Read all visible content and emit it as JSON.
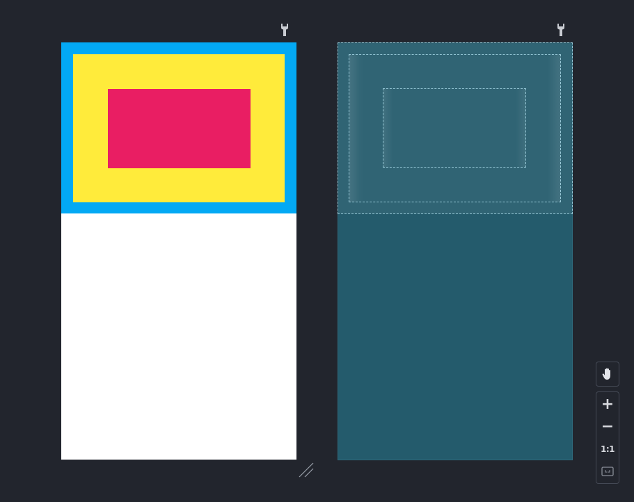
{
  "toolbar": {
    "design_settings_icon": "wrench-icon",
    "blueprint_settings_icon": "wrench-icon"
  },
  "zoom_controls": {
    "pan_icon": "hand-icon",
    "zoom_in_label": "+",
    "zoom_out_label": "−",
    "reset_label": "1:1",
    "fit_icon": "fit-screen-icon"
  },
  "colors": {
    "background": "#22252d",
    "design_surface": "#ffffff",
    "outer_layout": "#03a9f4",
    "middle_layout": "#ffeb3b",
    "inner_view": "#e91e63",
    "blueprint": "#245b6c"
  }
}
